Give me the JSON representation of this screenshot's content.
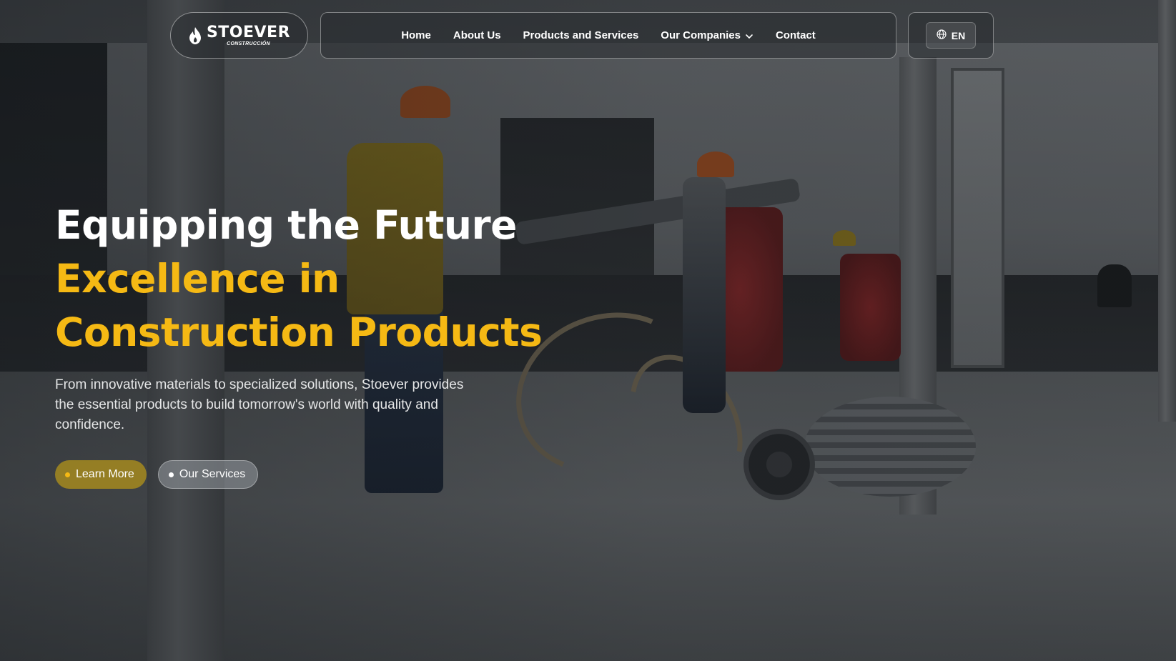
{
  "brand": {
    "name": "STOEVER",
    "sub": "CONSTRUCCIÓN"
  },
  "nav": {
    "items": [
      {
        "label": "Home"
      },
      {
        "label": "About Us"
      },
      {
        "label": "Products and Services"
      },
      {
        "label": "Our Companies",
        "has_dropdown": true
      },
      {
        "label": "Contact"
      }
    ]
  },
  "lang": {
    "label": "EN",
    "icon": "globe-icon"
  },
  "hero": {
    "title": "Equipping the Future",
    "highlight": "Excellence in Construction Products",
    "description": "From innovative materials to specialized solutions, Stoever provides the essential products to build tomorrow's world with quality and confidence.",
    "buttons": {
      "primary": "Learn More",
      "secondary": "Our Services"
    }
  },
  "colors": {
    "accent": "#f5b914",
    "text": "#ffffff"
  }
}
